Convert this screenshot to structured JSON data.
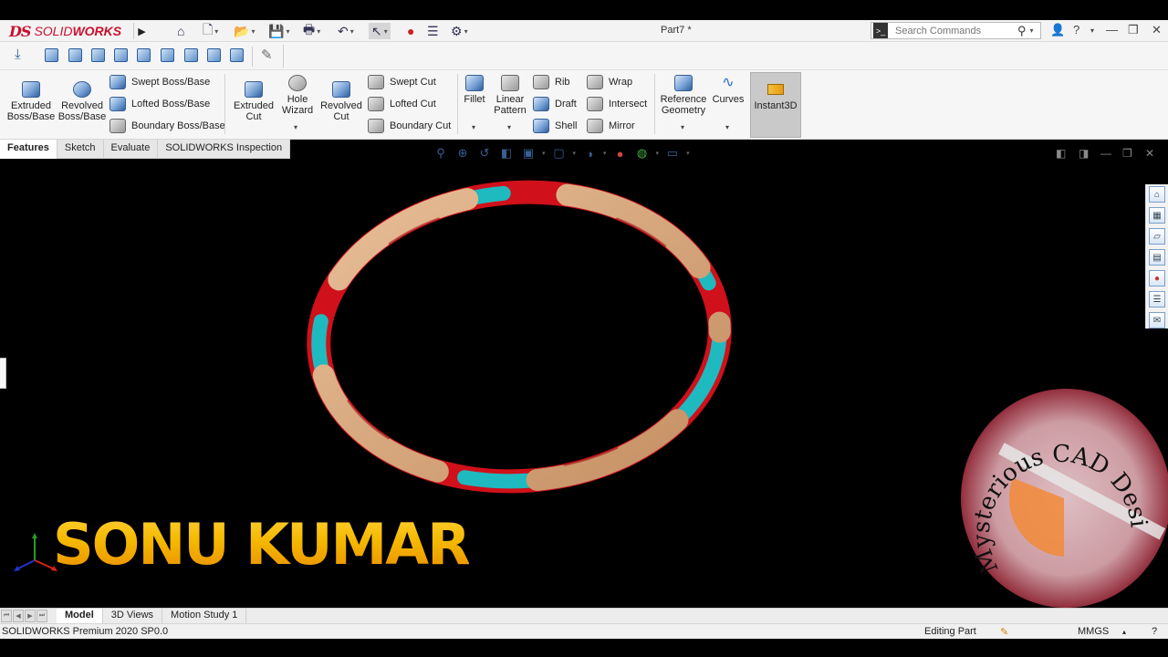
{
  "app": {
    "logo_prefix": "DS",
    "logo_brand_light": "SOLID",
    "logo_brand_bold": "WORKS",
    "document_title": "Part7 *"
  },
  "search": {
    "placeholder": "Search Commands"
  },
  "ribbon": {
    "extruded_boss": "Extruded Boss/Base",
    "revolved_boss": "Revolved Boss/Base",
    "swept_boss": "Swept Boss/Base",
    "lofted_boss": "Lofted Boss/Base",
    "boundary_boss": "Boundary Boss/Base",
    "extruded_cut": "Extruded Cut",
    "hole_wizard": "Hole Wizard",
    "revolved_cut": "Revolved Cut",
    "swept_cut": "Swept Cut",
    "lofted_cut": "Lofted Cut",
    "boundary_cut": "Boundary Cut",
    "fillet": "Fillet",
    "linear_pattern": "Linear Pattern",
    "rib": "Rib",
    "draft": "Draft",
    "shell": "Shell",
    "wrap": "Wrap",
    "intersect": "Intersect",
    "mirror": "Mirror",
    "reference_geometry": "Reference Geometry",
    "curves": "Curves",
    "instant3d": "Instant3D"
  },
  "tabs": [
    "Features",
    "Sketch",
    "Evaluate",
    "SOLIDWORKS Inspection"
  ],
  "overlay": {
    "name": "SONU KUMAR",
    "watermark": "Mysterious CAD Design"
  },
  "bottom_tabs": [
    "Model",
    "3D Views",
    "Motion Study 1"
  ],
  "status": {
    "version": "SOLIDWORKS Premium 2020 SP0.0",
    "mode": "Editing Part",
    "units": "MMGS"
  },
  "colors": {
    "ribbon_red": "#d0101a",
    "ribbon_cyan": "#1fb9c0",
    "ribbon_tan": "#d8a67c",
    "overlay_gold": "#f5b800",
    "brand_red": "#c8102e"
  }
}
